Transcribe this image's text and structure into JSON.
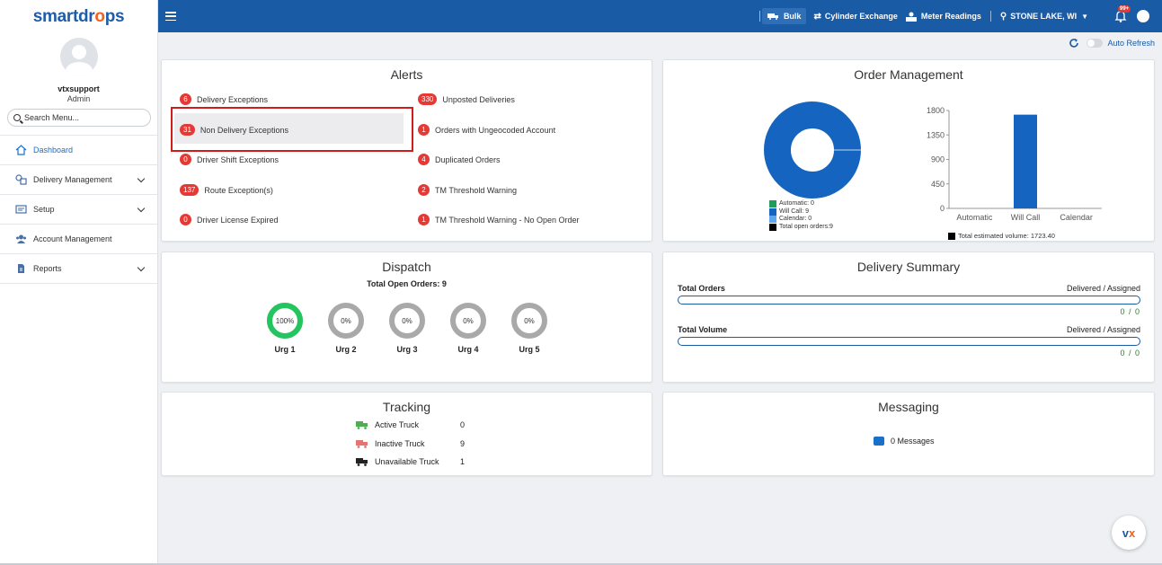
{
  "app": {
    "logo_main": "smartdr",
    "logo_flame": "o",
    "logo_end": "ps"
  },
  "user": {
    "name": "vtxsupport",
    "role": "Admin"
  },
  "search": {
    "placeholder": "Search Menu..."
  },
  "sidebar": {
    "items": [
      {
        "label": "Dashboard",
        "icon": "home-icon",
        "active": true,
        "expandable": false
      },
      {
        "label": "Delivery Management",
        "icon": "delivery-icon",
        "active": false,
        "expandable": true
      },
      {
        "label": "Setup",
        "icon": "setup-icon",
        "active": false,
        "expandable": true
      },
      {
        "label": "Account Management",
        "icon": "users-icon",
        "active": false,
        "expandable": false
      },
      {
        "label": "Reports",
        "icon": "report-icon",
        "active": false,
        "expandable": true
      }
    ]
  },
  "topbar": {
    "bulk": "Bulk",
    "cylinder_exchange": "Cylinder Exchange",
    "meter_readings": "Meter Readings",
    "location": "STONE LAKE, WI",
    "notification_count": "99+"
  },
  "refresh": {
    "label": "Auto Refresh"
  },
  "alerts": {
    "title": "Alerts",
    "left": [
      {
        "count": "6",
        "label": "Delivery Exceptions"
      },
      {
        "count": "31",
        "label": "Non Delivery Exceptions"
      },
      {
        "count": "0",
        "label": "Driver Shift Exceptions"
      },
      {
        "count": "137",
        "label": "Route Exception(s)"
      },
      {
        "count": "0",
        "label": "Driver License Expired"
      }
    ],
    "right": [
      {
        "count": "330",
        "label": "Unposted Deliveries"
      },
      {
        "count": "1",
        "label": "Orders with Ungeocoded Account"
      },
      {
        "count": "4",
        "label": "Duplicated Orders"
      },
      {
        "count": "2",
        "label": "TM Threshold Warning"
      },
      {
        "count": "1",
        "label": "TM Threshold Warning - No Open Order"
      }
    ]
  },
  "order_management": {
    "title": "Order Management",
    "donut_legend": [
      {
        "label": "Automatic: 0",
        "color": "#1e9e5a"
      },
      {
        "label": "Will Call: 9",
        "color": "#1565c0"
      },
      {
        "label": "Calendar: 0",
        "color": "#5da7f0"
      },
      {
        "label": "Total open orders:9",
        "color": "#000000"
      }
    ],
    "bar_total": "Total estimated volume: 1723.40"
  },
  "chart_data": [
    {
      "type": "pie",
      "categories": [
        "Automatic",
        "Will Call",
        "Calendar"
      ],
      "values": [
        0,
        9,
        0
      ],
      "colors": [
        "#1e9e5a",
        "#1565c0",
        "#5da7f0"
      ]
    },
    {
      "type": "bar",
      "categories": [
        "Automatic",
        "Will Call",
        "Calendar"
      ],
      "values": [
        0,
        1723.4,
        0
      ],
      "ylim": [
        0,
        1800
      ],
      "yticks": [
        0,
        450,
        900,
        1350,
        1800
      ],
      "color": "#1565c0"
    }
  ],
  "dispatch": {
    "title": "Dispatch",
    "subtitle": "Total Open Orders: 9",
    "rings": [
      {
        "label": "Urg 1",
        "value": "100%",
        "fraction": 1.0
      },
      {
        "label": "Urg 2",
        "value": "0%",
        "fraction": 0
      },
      {
        "label": "Urg 3",
        "value": "0%",
        "fraction": 0
      },
      {
        "label": "Urg 4",
        "value": "0%",
        "fraction": 0
      },
      {
        "label": "Urg 5",
        "value": "0%",
        "fraction": 0
      }
    ],
    "ring_fill_color": "#22c55e",
    "ring_empty_color": "#a9a9a9"
  },
  "delivery_summary": {
    "title": "Delivery Summary",
    "rows": [
      {
        "label": "Total Orders",
        "right": "Delivered / Assigned",
        "value": "0 / 0"
      },
      {
        "label": "Total Volume",
        "right": "Delivered / Assigned",
        "value": "0 / 0"
      }
    ]
  },
  "tracking": {
    "title": "Tracking",
    "rows": [
      {
        "label": "Active Truck",
        "count": "0",
        "color": "#4caf50"
      },
      {
        "label": "Inactive Truck",
        "count": "9",
        "color": "#e57373"
      },
      {
        "label": "Unavailable Truck",
        "count": "1",
        "color": "#222222"
      }
    ]
  },
  "messaging": {
    "title": "Messaging",
    "label": "0 Messages"
  },
  "fab": {
    "text": "v",
    "accent": "x"
  }
}
